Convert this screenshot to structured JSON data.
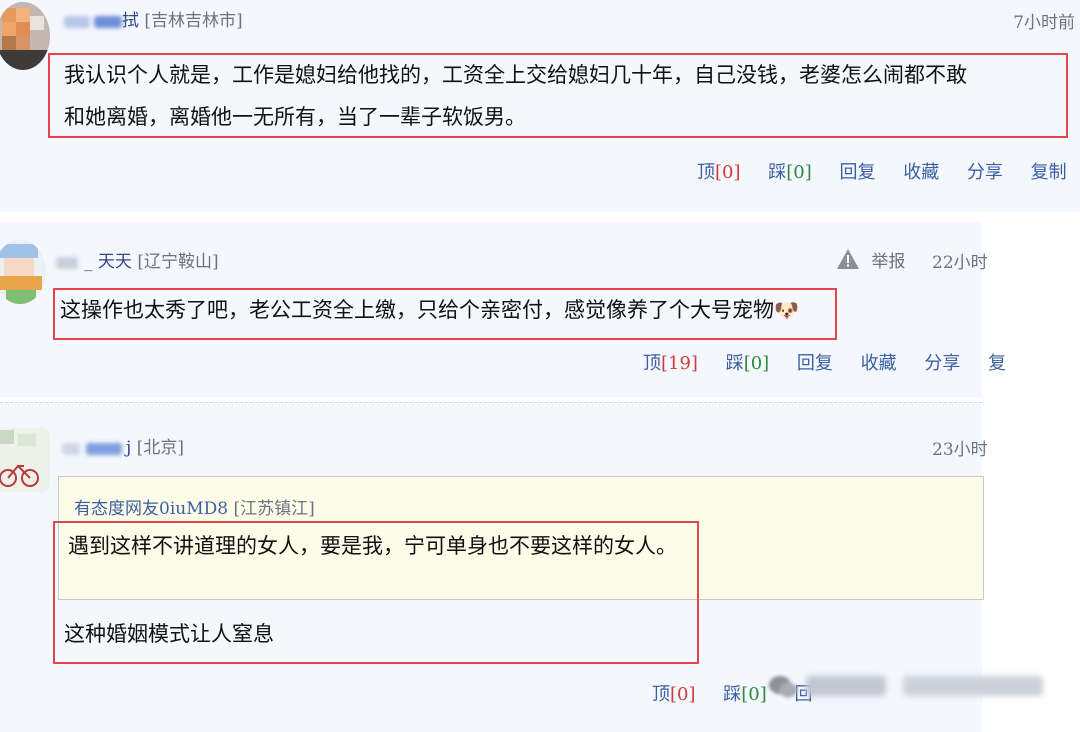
{
  "comments": [
    {
      "user_suffix": "拭",
      "location": "[吉林吉林市]",
      "time": "7小时前",
      "lines": [
        "我认识个人就是，工作是媳妇给他找的，工资全上交给媳妇几十年，自己没钱，老婆怎么闹都不敢",
        "和她离婚，离婚他一无所有，当了一辈子软饭男。"
      ],
      "actions": {
        "up_label": "顶",
        "up_count": "[0]",
        "down_label": "踩",
        "down_count": "[0]",
        "reply": "回复",
        "favorite": "收藏",
        "share": "分享",
        "copy": "复制"
      }
    },
    {
      "user_suffix": "_ 天天",
      "location": "[辽宁鞍山]",
      "report": "举报",
      "time": "22小时",
      "line": "这操作也太秀了吧，老公工资全上缴，只给个亲密付，感觉像养了个大号宠物",
      "emoji": "🐶",
      "actions": {
        "up_label": "顶",
        "up_count": "[19]",
        "down_label": "踩",
        "down_count": "[0]",
        "reply": "回复",
        "favorite": "收藏",
        "share": "分享",
        "copy": "复"
      }
    },
    {
      "user_suffix": "j",
      "location": "[北京]",
      "time": "23小时",
      "quote": {
        "author": "有态度网友0iuMD8",
        "author_location": "[江苏镇江]",
        "text": "遇到这样不讲道理的女人，要是我，宁可单身也不要这样的女人。"
      },
      "line": "这种婚姻模式让人窒息",
      "actions": {
        "up_label": "顶",
        "up_count": "[0]",
        "down_label": "踩",
        "down_count": "[0]",
        "reply": "回"
      }
    }
  ],
  "colors": {
    "highlight_box": "#e0484f",
    "link": "#3c5fa3",
    "up_count": "#d03b3b",
    "down_count": "#2f8a3e"
  }
}
